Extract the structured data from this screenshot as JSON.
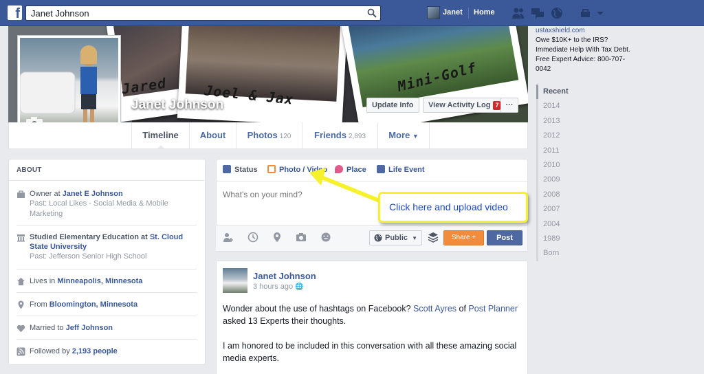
{
  "topbar": {
    "search_value": "Janet Johnson",
    "user_name": "Janet",
    "home_label": "Home"
  },
  "cover": {
    "name": "Janet Johnson",
    "scrawl_1": "Jared",
    "scrawl_2": "Joel & Jax",
    "scrawl_3": "Mini-Golf",
    "update_info_label": "Update Info",
    "activity_log_label": "View Activity Log",
    "activity_badge": "7",
    "more_dots": "···"
  },
  "tabs": [
    {
      "label": "Timeline",
      "count": ""
    },
    {
      "label": "About",
      "count": ""
    },
    {
      "label": "Photos",
      "count": "120"
    },
    {
      "label": "Friends",
      "count": "2,893"
    },
    {
      "label": "More",
      "count": ""
    }
  ],
  "about": {
    "heading": "ABOUT",
    "work_prefix": "Owner at ",
    "work_link": "Janet E Johnson",
    "work_past": "Past: Local Likes - Social Media & Mobile Marketing",
    "edu_prefix": "Studied Elementary Education at ",
    "edu_link": "St. Cloud State University",
    "edu_past": "Past: Jefferson Senior High School",
    "lives_prefix": "Lives in ",
    "lives_link": "Minneapolis, Minnesota",
    "from_prefix": "From ",
    "from_link": "Bloomington, Minnesota",
    "married_prefix": "Married to ",
    "married_link": "Jeff Johnson",
    "followed_prefix": "Followed by ",
    "followed_link": "2,193 people"
  },
  "composer": {
    "tab_status": "Status",
    "tab_photo": "Photo / Video",
    "tab_place": "Place",
    "tab_life": "Life Event",
    "placeholder": "What's on your mind?",
    "privacy_label": "Public",
    "share_label": "Share +",
    "post_label": "Post"
  },
  "callout": {
    "text": "Click here and upload video"
  },
  "post": {
    "author": "Janet Johnson",
    "time": "3 hours ago",
    "body_1_a": "Wonder about the use of hashtags on Facebook? ",
    "body_1_link1": "Scott Ayres",
    "body_1_b": " of ",
    "body_1_link2": "Post Planner",
    "body_1_c": " asked 13 Experts their thoughts.",
    "body_2": "I am honored to be included in this conversation with all these amazing social media experts."
  },
  "ad": {
    "url": "ustaxshield.com",
    "line1": "Owe $10K+ to the IRS?",
    "line2": "Immediate Help With Tax Debt.",
    "line3": "Free Expert Advice: 800-707-0042"
  },
  "years": [
    "Recent",
    "2014",
    "2013",
    "2012",
    "2011",
    "2010",
    "2009",
    "2008",
    "2007",
    "2004",
    "1989",
    "Born"
  ],
  "colors": {
    "brand": "#3b5998",
    "callout_border": "#f5f22d",
    "share": "#f08c3c"
  }
}
